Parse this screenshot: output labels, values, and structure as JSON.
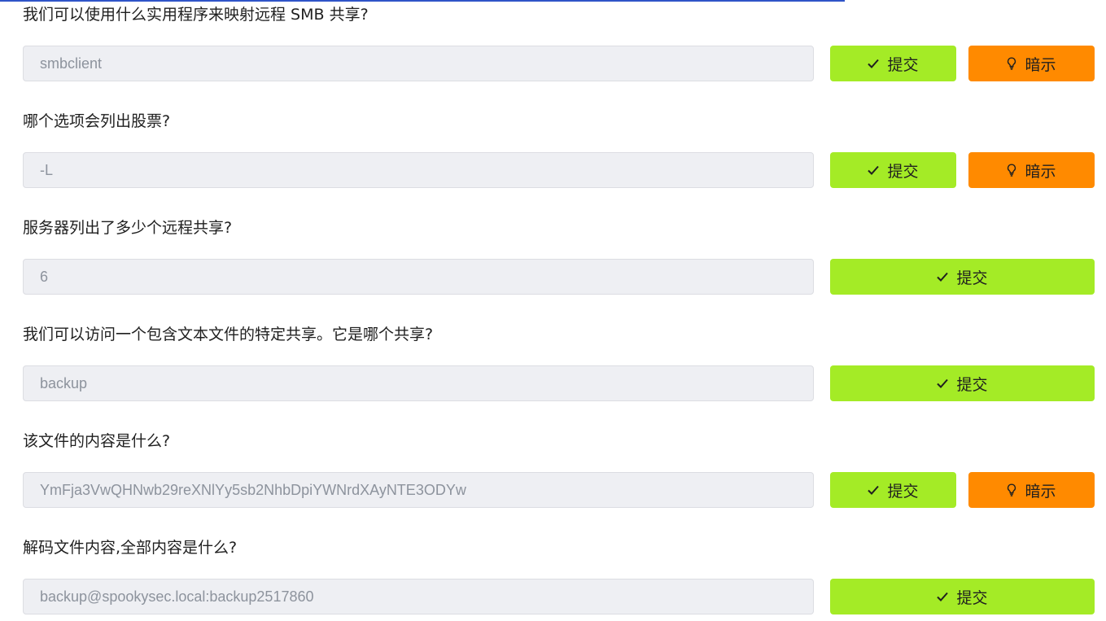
{
  "tasks": [
    {
      "question": "我们可以使用什么实用程序来映射远程 SMB 共享?",
      "answer": "smbclient",
      "submit_label": "提交",
      "hint_label": "暗示",
      "has_hint": true
    },
    {
      "question": "哪个选项会列出股票?",
      "answer": "-L",
      "submit_label": "提交",
      "hint_label": "暗示",
      "has_hint": true
    },
    {
      "question": "服务器列出了多少个远程共享?",
      "answer": "6",
      "submit_label": "提交",
      "has_hint": false
    },
    {
      "question": "我们可以访问一个包含文本文件的特定共享。它是哪个共享?",
      "answer": "backup",
      "submit_label": "提交",
      "has_hint": false
    },
    {
      "question": "该文件的内容是什么?",
      "answer": "YmFja3VwQHNwb29reXNlYy5sb2NhbDpiYWNrdXAyNTE3ODYw",
      "submit_label": "提交",
      "hint_label": "暗示",
      "has_hint": true
    },
    {
      "question": "解码文件内容,全部内容是什么?",
      "answer": "backup@spookysec.local:backup2517860",
      "submit_label": "提交",
      "has_hint": false
    }
  ],
  "colors": {
    "submit": "#a4eb26",
    "hint": "#ff8a00",
    "input_bg": "#eeeff3",
    "answer_text": "#8d939d",
    "top_accent": "#2f54c8"
  },
  "icons": {
    "submit": "check-icon",
    "hint": "lightbulb-icon"
  }
}
